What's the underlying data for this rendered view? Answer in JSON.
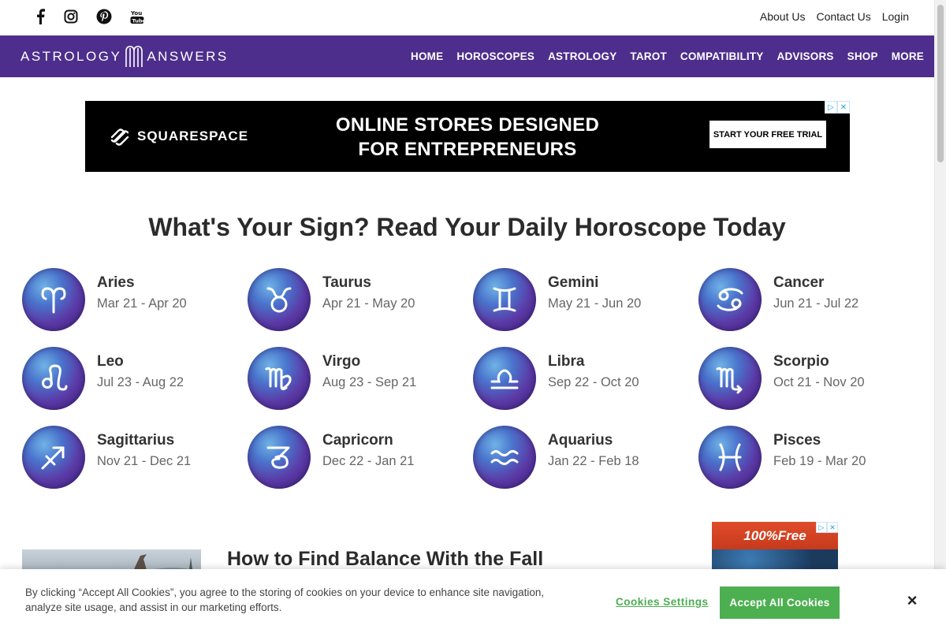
{
  "social": {
    "icons": [
      "facebook-icon",
      "instagram-icon",
      "pinterest-icon",
      "youtube-icon"
    ]
  },
  "toplinks": {
    "about": "About Us",
    "contact": "Contact Us",
    "login": "Login"
  },
  "brand": {
    "left": "ASTROLOGY",
    "right": "ANSWERS",
    "color": "#4e2e8c"
  },
  "nav": {
    "items": [
      "HOME",
      "HOROSCOPES",
      "ASTROLOGY",
      "TAROT",
      "COMPATIBILITY",
      "ADVISORS",
      "SHOP",
      "MORE"
    ]
  },
  "ad": {
    "brand": "SQUARESPACE",
    "headline_1": "ONLINE STORES DESIGNED",
    "headline_2": "FOR ENTREPRENEURS",
    "cta": "START YOUR FREE TRIAL"
  },
  "main": {
    "title": "What's Your Sign? Read Your Daily Horoscope Today"
  },
  "signs": [
    {
      "name": "Aries",
      "dates": "Mar 21 - Apr 20",
      "glyph": "♈"
    },
    {
      "name": "Taurus",
      "dates": "Apr 21 - May 20",
      "glyph": "♉"
    },
    {
      "name": "Gemini",
      "dates": "May 21 - Jun 20",
      "glyph": "♊"
    },
    {
      "name": "Cancer",
      "dates": "Jun 21 - Jul 22",
      "glyph": "♋"
    },
    {
      "name": "Leo",
      "dates": "Jul 23 - Aug 22",
      "glyph": "♌"
    },
    {
      "name": "Virgo",
      "dates": "Aug 23 - Sep 21",
      "glyph": "♍"
    },
    {
      "name": "Libra",
      "dates": "Sep 22 - Oct 20",
      "glyph": "♎"
    },
    {
      "name": "Scorpio",
      "dates": "Oct 21 - Nov 20",
      "glyph": "♏"
    },
    {
      "name": "Sagittarius",
      "dates": "Nov 21 - Dec 21",
      "glyph": "♐"
    },
    {
      "name": "Capricorn",
      "dates": "Dec 22 - Jan 21",
      "glyph": "♑"
    },
    {
      "name": "Aquarius",
      "dates": "Jan 22 - Feb 18",
      "glyph": "♒"
    },
    {
      "name": "Pisces",
      "dates": "Feb 19 - Mar 20",
      "glyph": "♓"
    }
  ],
  "article": {
    "title": "How to Find Balance With the Fall"
  },
  "sidead": {
    "label": "100%Free"
  },
  "cookie": {
    "text": "By clicking “Accept All Cookies”, you agree to the storing of cookies on your device to enhance site navigation, analyze site usage, and assist in our marketing efforts.",
    "settings": "Cookies Settings",
    "accept": "Accept All Cookies",
    "close": "×",
    "accent": "#4caf50"
  }
}
